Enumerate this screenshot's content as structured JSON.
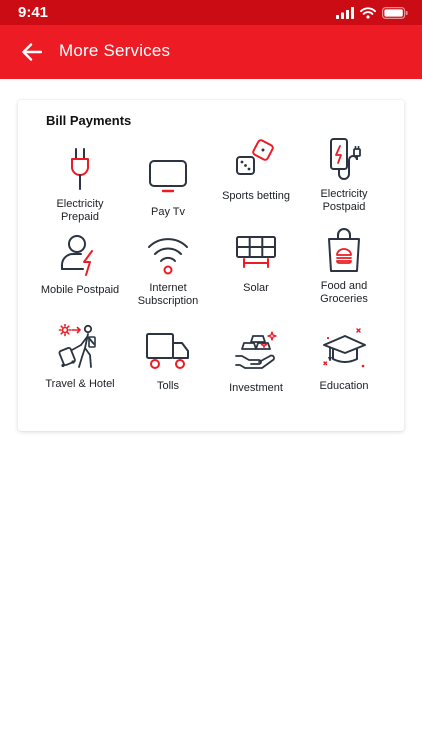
{
  "status_bar": {
    "time": "9:41"
  },
  "app_bar": {
    "title": "More Services",
    "back_icon": "arrow-left-icon"
  },
  "section": {
    "title": "Bill Payments",
    "services": [
      {
        "label": "Electricity Prepaid",
        "icon": "plug-icon"
      },
      {
        "label": "Pay Tv",
        "icon": "tv-icon"
      },
      {
        "label": "Sports betting",
        "icon": "dice-icon"
      },
      {
        "label": "Electricity Postpaid",
        "icon": "charger-icon"
      },
      {
        "label": "Mobile Postpaid",
        "icon": "user-lightning-icon"
      },
      {
        "label": "Internet Subscription",
        "icon": "wifi-icon"
      },
      {
        "label": "Solar",
        "icon": "solar-panel-icon"
      },
      {
        "label": "Food and Groceries",
        "icon": "grocery-bag-icon"
      },
      {
        "label": "Travel & Hotel",
        "icon": "traveler-icon"
      },
      {
        "label": "Tolls",
        "icon": "truck-icon"
      },
      {
        "label": "Investment",
        "icon": "gold-bars-icon"
      },
      {
        "label": "Education",
        "icon": "graduation-cap-icon"
      }
    ]
  },
  "colors": {
    "brand": "#ed1b24",
    "status_bar": "#cc0c14",
    "icon_dark": "#2b3440",
    "icon_accent": "#ed1b24"
  }
}
